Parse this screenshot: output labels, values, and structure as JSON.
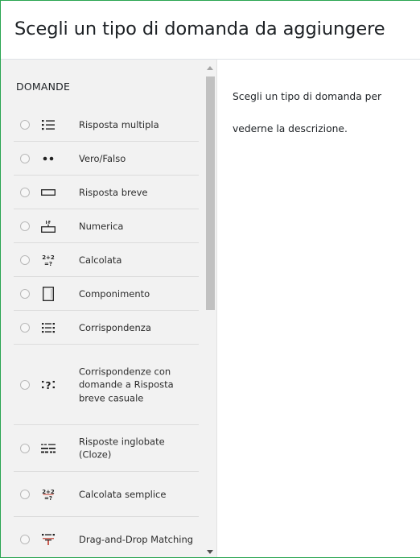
{
  "dialog": {
    "title": "Scegli un tipo di domanda da aggiungere"
  },
  "sidebar": {
    "section_label": "DOMANDE",
    "items": [
      {
        "label": "Risposta multipla",
        "icon": "multiple-choice-icon"
      },
      {
        "label": "Vero/Falso",
        "icon": "true-false-icon"
      },
      {
        "label": "Risposta breve",
        "icon": "short-answer-icon"
      },
      {
        "label": "Numerica",
        "icon": "numerical-icon"
      },
      {
        "label": "Calcolata",
        "icon": "calculated-icon"
      },
      {
        "label": "Componimento",
        "icon": "essay-icon"
      },
      {
        "label": "Corrispondenza",
        "icon": "matching-icon"
      },
      {
        "label": "Corrispondenze con domande a Risposta breve casuale",
        "icon": "random-short-answer-matching-icon"
      },
      {
        "label": "Risposte inglobate (Cloze)",
        "icon": "cloze-icon"
      },
      {
        "label": "Calcolata semplice",
        "icon": "calculated-simple-icon"
      },
      {
        "label": "Drag-and-Drop Matching",
        "icon": "drag-drop-matching-icon"
      }
    ]
  },
  "content": {
    "description_line1": "Scegli un tipo di domanda per",
    "description_line2": "vederne la descrizione."
  },
  "colors": {
    "accent_border": "#2aa551",
    "sidebar_bg": "#f2f2f2",
    "scrollbar_thumb": "#c1c1c1"
  }
}
